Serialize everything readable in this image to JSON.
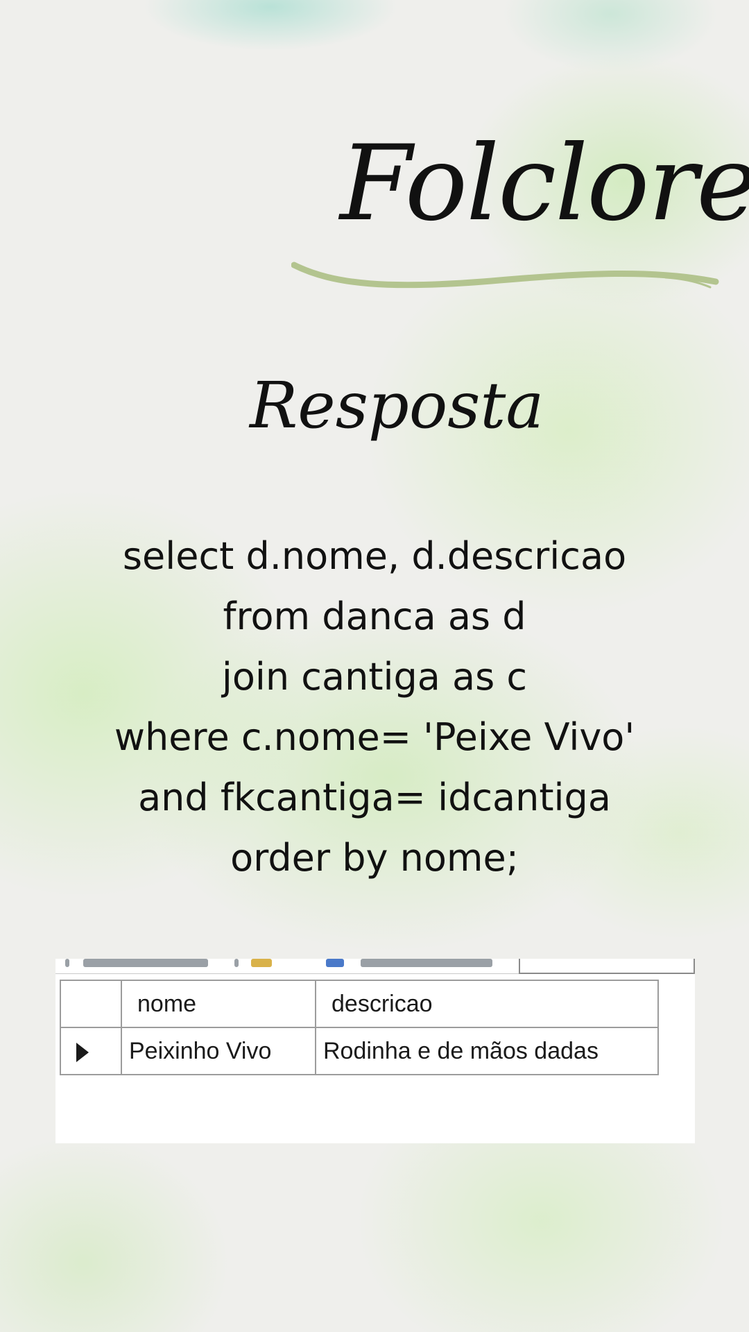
{
  "header": {
    "title": "Folclore",
    "subtitle": "Resposta"
  },
  "query": {
    "lines": [
      "select d.nome, d.descricao",
      "from danca as d",
      "join cantiga as c",
      "where c.nome= 'Peixe Vivo'",
      "and fkcantiga= idcantiga",
      "order by nome;"
    ]
  },
  "result_grid": {
    "columns": [
      "nome",
      "descricao"
    ],
    "rows": [
      {
        "nome": "Peixinho Vivo",
        "descricao": "Rodinha e de mãos dadas"
      }
    ],
    "row_indicator_icon": "play-triangle-icon"
  },
  "colors": {
    "text": "#111111",
    "underline": "#b3c48f",
    "watercolor": "#c8ecaa"
  }
}
